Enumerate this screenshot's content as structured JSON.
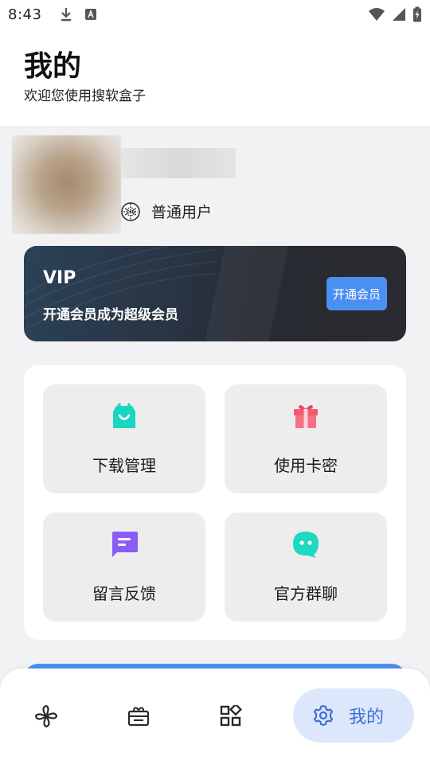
{
  "status_bar": {
    "time": "8:43",
    "icons_left": [
      "download-icon",
      "a-icon"
    ],
    "icons_right": [
      "wifi-icon",
      "signal-icon",
      "battery-icon"
    ]
  },
  "header": {
    "title": "我的",
    "subtitle": "欢迎您使用搜软盒子"
  },
  "profile": {
    "user_type": "普通用户"
  },
  "vip": {
    "title": "VIP",
    "description": "开通会员成为超级会员",
    "button_label": "开通会员"
  },
  "menu": {
    "items": [
      {
        "label": "下载管理",
        "icon": "shopping-bag-icon",
        "color": "#19d6c0"
      },
      {
        "label": "使用卡密",
        "icon": "gift-icon",
        "color": "#f25a6e"
      },
      {
        "label": "留言反馈",
        "icon": "message-icon",
        "color": "#8b5cf6"
      },
      {
        "label": "官方群聊",
        "icon": "chat-bubble-icon",
        "color": "#1ed8c2"
      }
    ]
  },
  "bottom_nav": {
    "items": [
      {
        "icon": "pinwheel-icon"
      },
      {
        "icon": "ticket-icon"
      },
      {
        "icon": "apps-grid-icon"
      },
      {
        "icon": "gear-icon",
        "label": "我的",
        "active": true
      }
    ]
  },
  "colors": {
    "accent": "#4c8ff2",
    "active_nav_bg": "#dde7fb",
    "active_nav_text": "#3e6fd8"
  }
}
